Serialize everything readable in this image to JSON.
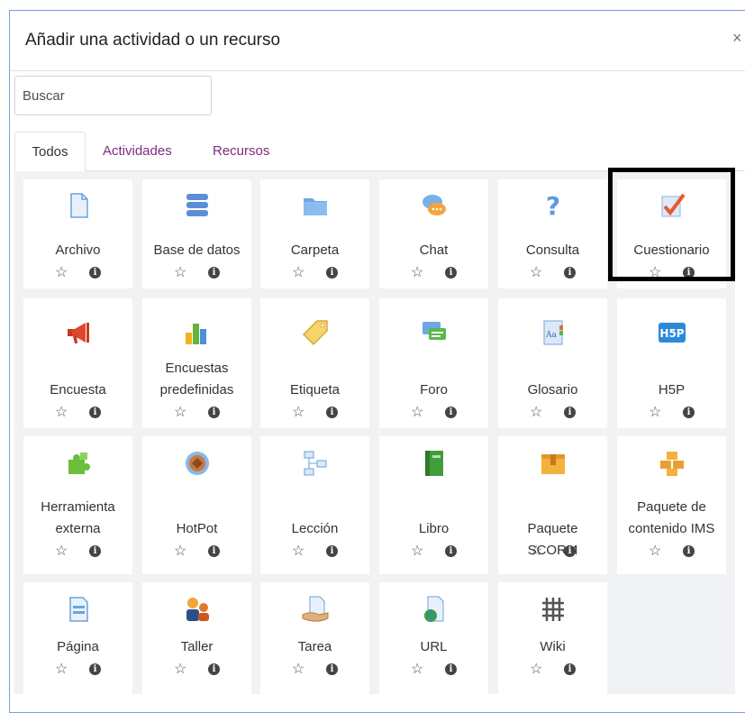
{
  "dialog": {
    "title": "Añadir una actividad o un recurso",
    "close_glyph": "×"
  },
  "search": {
    "placeholder": "Buscar",
    "value": ""
  },
  "tabs": [
    {
      "label": "Todos",
      "active": true
    },
    {
      "label": "Actividades",
      "active": false
    },
    {
      "label": "Recursos",
      "active": false
    }
  ],
  "colors": {
    "accent": "#7c2b7f",
    "border_highlight": "#000000",
    "grid_bg": "#f1f2f4"
  },
  "star_glyph": "☆",
  "info_glyph": "i",
  "items": [
    {
      "label": "Archivo",
      "icon": "file-icon"
    },
    {
      "label": "Base de datos",
      "icon": "database-icon"
    },
    {
      "label": "Carpeta",
      "icon": "folder-icon"
    },
    {
      "label": "Chat",
      "icon": "chat-icon"
    },
    {
      "label": "Consulta",
      "icon": "question-icon"
    },
    {
      "label": "Cuestionario",
      "icon": "quiz-icon",
      "highlighted": true
    },
    {
      "label": "Encuesta",
      "icon": "megaphone-icon"
    },
    {
      "label": "Encuestas predefinidas",
      "icon": "bar-chart-icon"
    },
    {
      "label": "Etiqueta",
      "icon": "tag-icon"
    },
    {
      "label": "Foro",
      "icon": "forum-icon"
    },
    {
      "label": "Glosario",
      "icon": "glossary-icon"
    },
    {
      "label": "H5P",
      "icon": "h5p-icon"
    },
    {
      "label": "Herramienta externa",
      "icon": "puzzle-icon"
    },
    {
      "label": "HotPot",
      "icon": "hotpot-icon"
    },
    {
      "label": "Lección",
      "icon": "lesson-icon"
    },
    {
      "label": "Libro",
      "icon": "book-icon"
    },
    {
      "label": "Paquete SCORM",
      "icon": "scorm-package-icon"
    },
    {
      "label": "Paquete de contenido IMS",
      "icon": "ims-package-icon"
    },
    {
      "label": "Página",
      "icon": "page-icon"
    },
    {
      "label": "Taller",
      "icon": "workshop-icon"
    },
    {
      "label": "Tarea",
      "icon": "assignment-icon"
    },
    {
      "label": "URL",
      "icon": "url-icon"
    },
    {
      "label": "Wiki",
      "icon": "wiki-icon"
    }
  ]
}
